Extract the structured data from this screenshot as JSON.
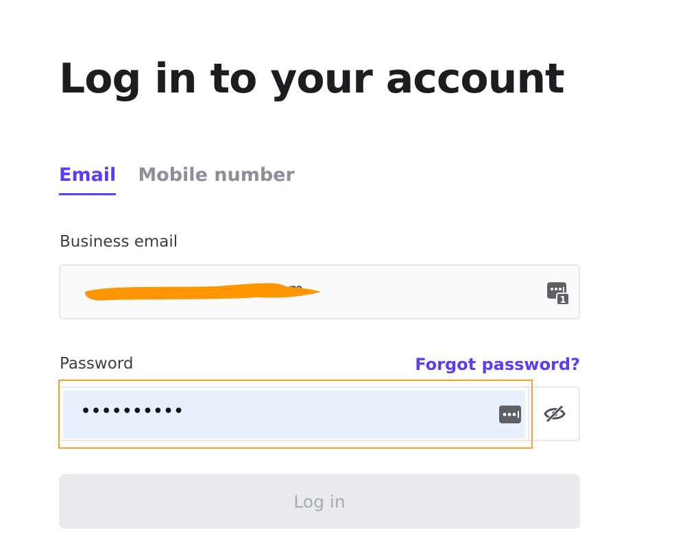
{
  "title": "Log in to your account",
  "tabs": [
    {
      "label": "Email",
      "active": true
    },
    {
      "label": "Mobile number",
      "active": false
    }
  ],
  "email": {
    "label": "Business email",
    "value": "m",
    "redacted": true,
    "redaction_color": "#ff9500"
  },
  "password": {
    "label": "Password",
    "forgot_label": "Forgot password?",
    "masked_value": "••••••••••",
    "autofill_color": "#e8f0fe"
  },
  "login_button": {
    "label": "Log in",
    "enabled": false
  },
  "password_manager_badge_count": "1",
  "colors": {
    "accent": "#5b3df5",
    "focus_outline": "#f4a02b",
    "disabled_bg": "#e9eaed",
    "disabled_text": "#a6aab2"
  }
}
